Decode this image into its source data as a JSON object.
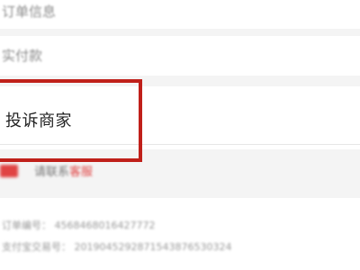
{
  "rows": {
    "order_info": "订单信息",
    "paid": "实付款",
    "complaint": "投诉商家"
  },
  "hint": {
    "prefix": "",
    "text": "请联系",
    "red": "客服",
    "suffix": ""
  },
  "info": {
    "line1": "订单编号：  4568468016427772",
    "line2": "支付宝交易号：  2019045292871543876530324",
    "line3": ""
  },
  "colors": {
    "highlight": "#c0201a",
    "accent": "#e04343"
  }
}
